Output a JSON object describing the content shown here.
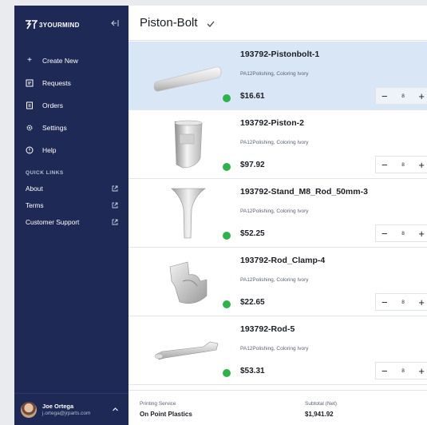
{
  "sidebar": {
    "brand": "3YOURMIND",
    "nav": [
      {
        "icon": "plus-icon",
        "label": "Create New"
      },
      {
        "icon": "requests-icon",
        "label": "Requests"
      },
      {
        "icon": "orders-icon",
        "label": "Orders"
      },
      {
        "icon": "gear-icon",
        "label": "Settings"
      },
      {
        "icon": "help-icon",
        "label": "Help"
      }
    ],
    "quick_links_title": "QUICK LINKS",
    "quick_links": [
      {
        "label": "About",
        "icon": "external-link-icon"
      },
      {
        "label": "Terms",
        "icon": "external-link-icon"
      },
      {
        "label": "Customer Support",
        "icon": "external-link-icon"
      }
    ],
    "user": {
      "name": "Joe Ortega",
      "email": "j.ortega@jrparts.com"
    }
  },
  "header": {
    "title": "Piston-Bolt"
  },
  "parts": [
    {
      "name": "193792-Pistonbolt-1",
      "spec": "PA12Polishing, Coloring Ivory",
      "price": "$16.61",
      "quantity": "8",
      "selected": true,
      "status_color": "#2cb34a"
    },
    {
      "name": "193792-Piston-2",
      "spec": "PA12Polishing, Coloring Ivory",
      "price": "$97.92",
      "quantity": "8",
      "selected": false,
      "status_color": "#2cb34a"
    },
    {
      "name": "193792-Stand_M8_Rod_50mm-3",
      "spec": "PA12Polishing, Coloring Ivory",
      "price": "$52.25",
      "quantity": "8",
      "selected": false,
      "status_color": "#2cb34a"
    },
    {
      "name": "193792-Rod_Clamp-4",
      "spec": "PA12Polishing, Coloring Ivory",
      "price": "$22.65",
      "quantity": "8",
      "selected": false,
      "status_color": "#2cb34a"
    },
    {
      "name": "193792-Rod-5",
      "spec": "PA12Polishing, Coloring Ivory",
      "price": "$53.31",
      "quantity": "8",
      "selected": false,
      "status_color": "#2cb34a"
    }
  ],
  "stepper": {
    "minus": "−",
    "plus": "+"
  },
  "footer": {
    "service_label": "Printing Service",
    "service_value": "On Point Plastics",
    "subtotal_label": "Subtotal (Net)",
    "subtotal_value": "$1,941.92"
  },
  "colors": {
    "sidebar": "#1e2a55",
    "selected_row": "#d9e6f6",
    "status_ok": "#2cb34a"
  }
}
